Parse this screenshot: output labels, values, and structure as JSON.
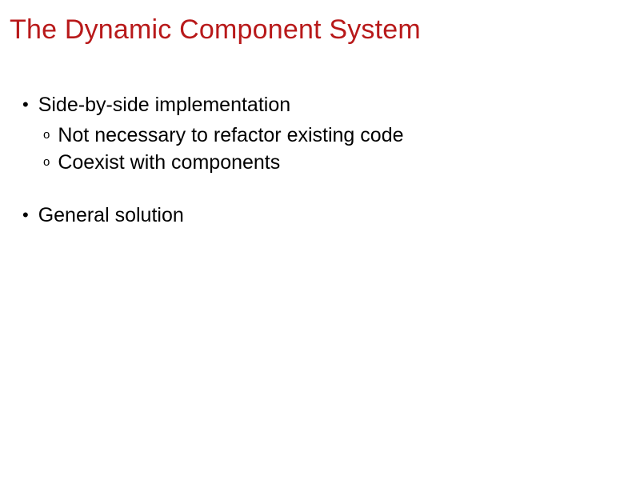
{
  "slide": {
    "title": "The Dynamic Component System",
    "bullets": [
      {
        "text": "Side-by-side implementation",
        "sub": [
          "Not necessary to refactor existing code",
          "Coexist with components"
        ]
      },
      {
        "text": "General solution",
        "sub": []
      }
    ]
  }
}
